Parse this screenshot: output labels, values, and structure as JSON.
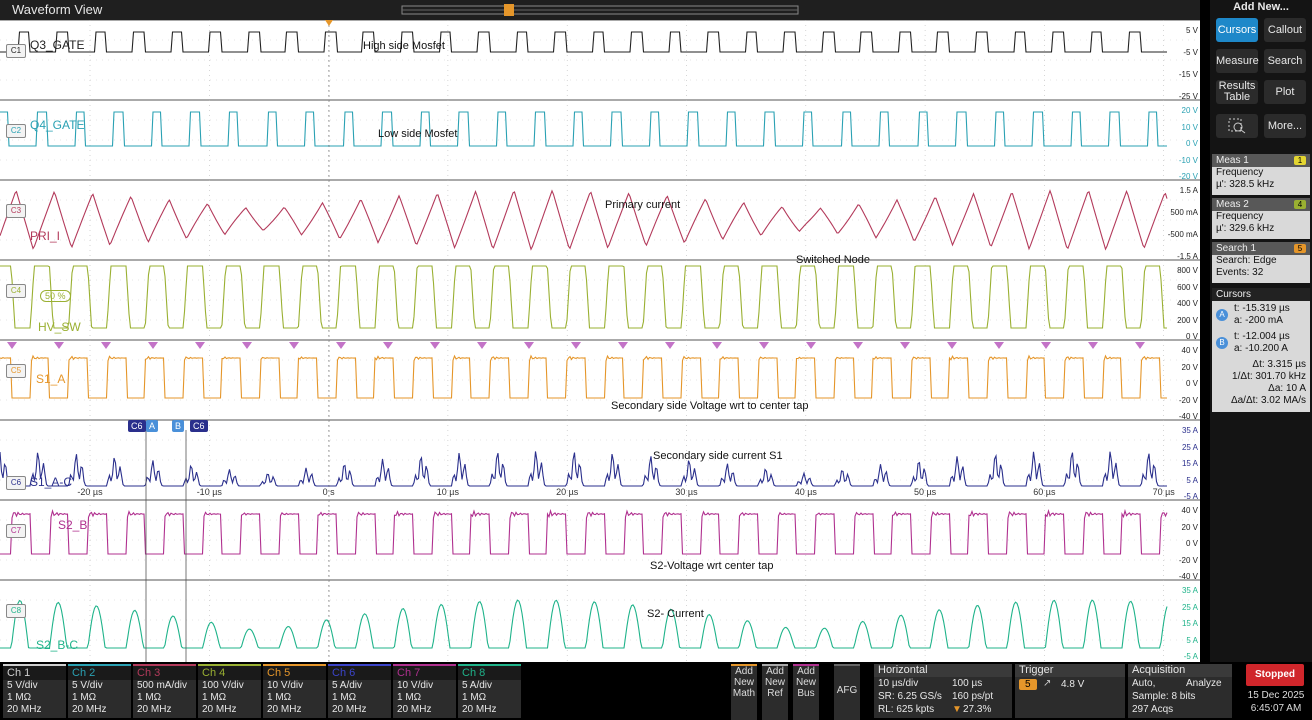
{
  "window_title": "Waveform View",
  "channels": [
    {
      "id": "C1",
      "label": "Q3_GATE",
      "color": "#222222",
      "annotation": "High side Mosfet",
      "ticks": [
        "5 V",
        "-5 V",
        "-15 V",
        "-25 V"
      ]
    },
    {
      "id": "C2",
      "label": "Q4_GATE",
      "color": "#2aa1b3",
      "annotation": "Low side Mosfet",
      "ticks": [
        "20 V",
        "10 V",
        "0 V",
        "-10 V",
        "-20 V"
      ]
    },
    {
      "id": "C3",
      "label": "PRI_I",
      "color": "#b33a5b",
      "annotation": "Primary current",
      "ticks": [
        "1.5 A",
        "500 mA",
        "-500 mA",
        "-1.5 A"
      ]
    },
    {
      "id": "C4",
      "label": "HV_SW",
      "color": "#9ab032",
      "annotation": "Switched Node",
      "ticks": [
        "800 V",
        "600 V",
        "400 V",
        "200 V",
        "0 V"
      ]
    },
    {
      "id": "C5",
      "label": "S1_A",
      "color": "#e5962a",
      "annotation": "Secondary side Voltage wrt to center tap",
      "ticks": [
        "40 V",
        "20 V",
        "0 V",
        "-20 V",
        "-40 V"
      ]
    },
    {
      "id": "C6",
      "label": "S1_A-C",
      "color": "#2a2f8c",
      "annotation": "Secondary side current S1",
      "ticks": [
        "35 A",
        "25 A",
        "15 A",
        "5 A",
        "-5 A"
      ]
    },
    {
      "id": "C7",
      "label": "S2_B",
      "color": "#b0308f",
      "annotation": "S2-Voltage wrt center tap",
      "ticks": [
        "40 V",
        "20 V",
        "0 V",
        "-20 V",
        "-40 V"
      ]
    },
    {
      "id": "C8",
      "label": "S2_B-C",
      "color": "#1fb38a",
      "annotation": "S2- Current",
      "ticks": [
        "35 A",
        "25 A",
        "15 A",
        "5 A",
        "-5 A"
      ]
    }
  ],
  "time_axis": [
    "-20 µs",
    "-10 µs",
    "0 s",
    "10 µs",
    "20 µs",
    "30 µs",
    "40 µs",
    "50 µs",
    "60 µs",
    "70 µs"
  ],
  "hv_pct_label": "50 %",
  "cursor_tags": [
    "C6",
    "A",
    "B",
    "C6"
  ],
  "side": {
    "header": "Add New...",
    "buttons": {
      "cursors": "Cursors",
      "callout": "Callout",
      "measure": "Measure",
      "search": "Search",
      "results": "Results Table",
      "plot": "Plot",
      "more": "More..."
    },
    "meas1": {
      "title": "Meas 1",
      "badge": "1",
      "type": "Frequency",
      "value": "µ': 328.5 kHz"
    },
    "meas2": {
      "title": "Meas 2",
      "badge": "4",
      "type": "Frequency",
      "value": "µ': 329.6 kHz"
    },
    "search1": {
      "title": "Search 1",
      "badge": "5",
      "type": "Search: Edge",
      "events": "Events: 32"
    },
    "cursors": {
      "title": "Cursors",
      "a_t": "t: -15.319 µs",
      "a_a": "a: -200 mA",
      "b_t": "t: -12.004 µs",
      "b_a": "a: -10.200 A",
      "dt": "Δt: 3.315 µs",
      "inv_dt": "1/Δt: 301.70 kHz",
      "da": "Δa: 10 A",
      "dadt": "Δa/Δt: 3.02 MA/s"
    }
  },
  "bottom_channels": [
    {
      "name": "Ch 1",
      "scale": "5 V/div",
      "imp": "1 MΩ",
      "bw": "20 MHz",
      "color": "#cfcfcf"
    },
    {
      "name": "Ch 2",
      "scale": "5 V/div",
      "imp": "1 MΩ",
      "bw": "20 MHz",
      "color": "#2aa1b3"
    },
    {
      "name": "Ch 3",
      "scale": "500 mA/div",
      "imp": "1 MΩ",
      "bw": "20 MHz",
      "color": "#b33a5b"
    },
    {
      "name": "Ch 4",
      "scale": "100 V/div",
      "imp": "1 MΩ",
      "bw": "20 MHz",
      "color": "#9ab032"
    },
    {
      "name": "Ch 5",
      "scale": "10 V/div",
      "imp": "1 MΩ",
      "bw": "20 MHz",
      "color": "#e5962a"
    },
    {
      "name": "Ch 6",
      "scale": "5 A/div",
      "imp": "1 MΩ",
      "bw": "20 MHz",
      "color": "#3b44c9"
    },
    {
      "name": "Ch 7",
      "scale": "10 V/div",
      "imp": "1 MΩ",
      "bw": "20 MHz",
      "color": "#b0308f"
    },
    {
      "name": "Ch 8",
      "scale": "5 A/div",
      "imp": "1 MΩ",
      "bw": "20 MHz",
      "color": "#1fb38a"
    }
  ],
  "add_buttons": {
    "math": "Add New Math",
    "ref": "Add New Ref",
    "bus": "Add New Bus",
    "afg": "AFG"
  },
  "horizontal": {
    "title": "Horizontal",
    "scale": "10 µs/div",
    "pos": "100 µs",
    "sr": "SR: 6.25 GS/s",
    "ptpt": "160 ps/pt",
    "rl": "RL: 625 kpts",
    "pct": "27.3%"
  },
  "trigger": {
    "title": "Trigger",
    "src": "5",
    "level": "4.8 V"
  },
  "acquisition": {
    "title": "Acquisition",
    "mode": "Auto,",
    "analyze": "Analyze",
    "sample": "Sample: 8 bits",
    "acqs": "297 Acqs"
  },
  "status": {
    "state": "Stopped",
    "date": "15 Dec 2025",
    "time": "6:45:07 AM"
  }
}
